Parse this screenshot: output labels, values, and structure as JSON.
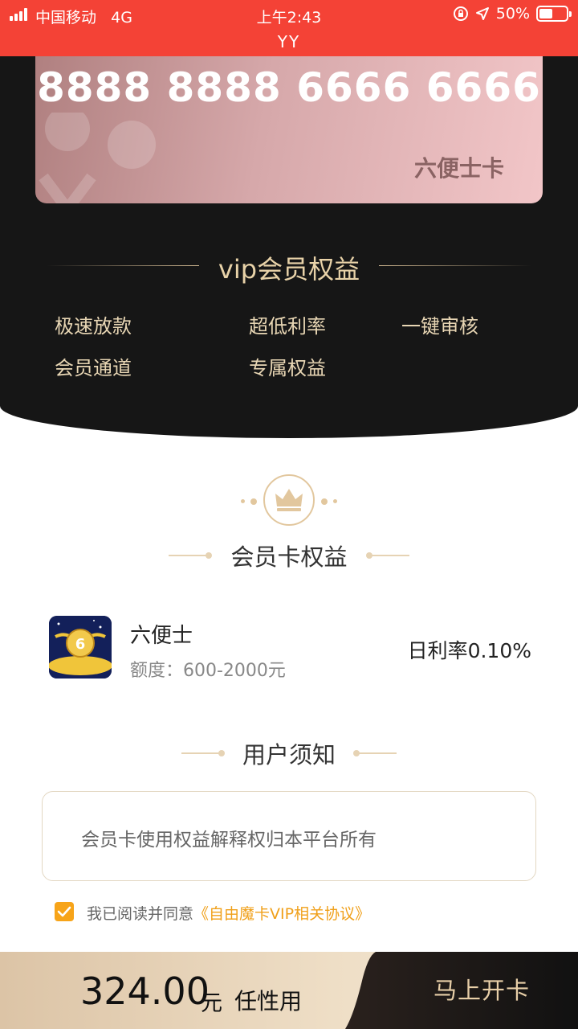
{
  "status_bar": {
    "carrier": "中国移动",
    "network": "4G",
    "time": "上午2:43",
    "battery": "50%",
    "battery_level": 0.5,
    "background_color": "#f44236"
  },
  "page_title": "YY",
  "card": {
    "number": "8888 8888 6666 6666",
    "name": "六便士卡"
  },
  "vip": {
    "title": "vip会员权益",
    "benefits": [
      "极速放款",
      "超低利率",
      "一键审核",
      "会员通道",
      "专属权益"
    ]
  },
  "member_card_section": {
    "title": "会员卡权益"
  },
  "product": {
    "name": "六便士",
    "quota": "额度：600-2000元",
    "rate": "日利率0.10%",
    "icon_label": "6"
  },
  "notice": {
    "title": "用户须知",
    "text": "会员卡使用权益解释权归本平台所有"
  },
  "agreement": {
    "checked": true,
    "prefix": "我已阅读并同意",
    "link": "《自由魔卡VIP相关协议》"
  },
  "footer": {
    "price": "324.00",
    "unit": "元",
    "note": "任性用",
    "button": "马上开卡"
  },
  "colors": {
    "accent_orange": "#f7a419",
    "gold": "#e8d2a8",
    "dark_bg": "#161616"
  }
}
